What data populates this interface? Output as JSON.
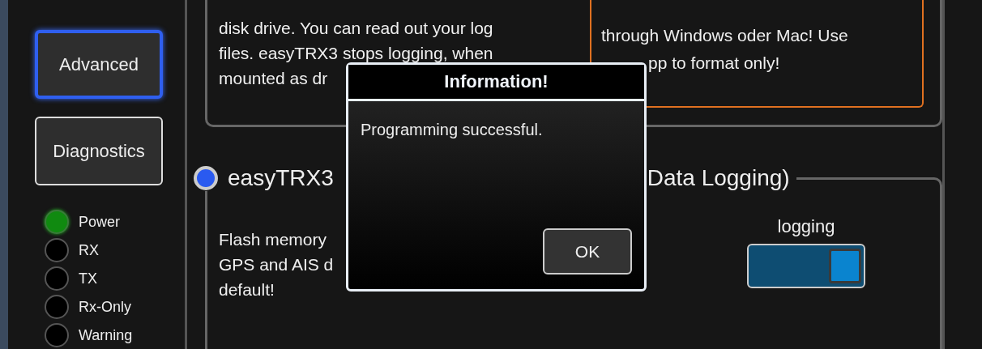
{
  "sidebar": {
    "buttons": [
      {
        "label": "Advanced",
        "selected": true
      },
      {
        "label": "Diagnostics",
        "selected": false
      }
    ],
    "indicators": [
      {
        "label": "Power",
        "on": true
      },
      {
        "label": "RX",
        "on": false
      },
      {
        "label": "TX",
        "on": false
      },
      {
        "label": "Rx-Only",
        "on": false
      },
      {
        "label": "Warning",
        "on": false
      }
    ]
  },
  "storage_panel": {
    "description_lines": [
      "disk drive. You can read out your log",
      "files.  easyTRX3 stops logging, when",
      "mounted as dr"
    ],
    "warning_lines": [
      "through Windows oder Mac! Use",
      "pp to format only!"
    ]
  },
  "logging_section": {
    "selected": true,
    "title_start": "easyTRX3",
    "title_end": "Data Logging)",
    "description_lines": [
      "Flash memory",
      "GPS and AIS d",
      "default!"
    ],
    "switch": {
      "label": "logging",
      "on": true
    }
  },
  "dialog": {
    "title": "Information!",
    "message": "Programming successful.",
    "buttons": [
      "OK"
    ]
  }
}
